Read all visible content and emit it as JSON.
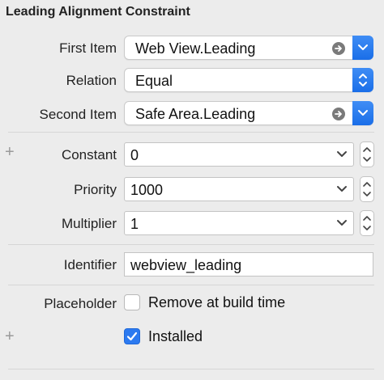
{
  "title": "Leading Alignment Constraint",
  "first_item": {
    "label": "First Item",
    "value": "Web View.Leading"
  },
  "relation": {
    "label": "Relation",
    "value": "Equal"
  },
  "second_item": {
    "label": "Second Item",
    "value": "Safe Area.Leading"
  },
  "constant": {
    "label": "Constant",
    "value": "0"
  },
  "priority": {
    "label": "Priority",
    "value": "1000"
  },
  "multiplier": {
    "label": "Multiplier",
    "value": "1"
  },
  "identifier": {
    "label": "Identifier",
    "value": "webview_leading"
  },
  "placeholder": {
    "label": "Placeholder",
    "checkbox_label": "Remove at build time",
    "checked": false
  },
  "installed": {
    "checkbox_label": "Installed",
    "checked": true
  },
  "plus_glyph": "+",
  "colors": {
    "accent": "#2c7af0",
    "panel_bg": "#ececec"
  }
}
